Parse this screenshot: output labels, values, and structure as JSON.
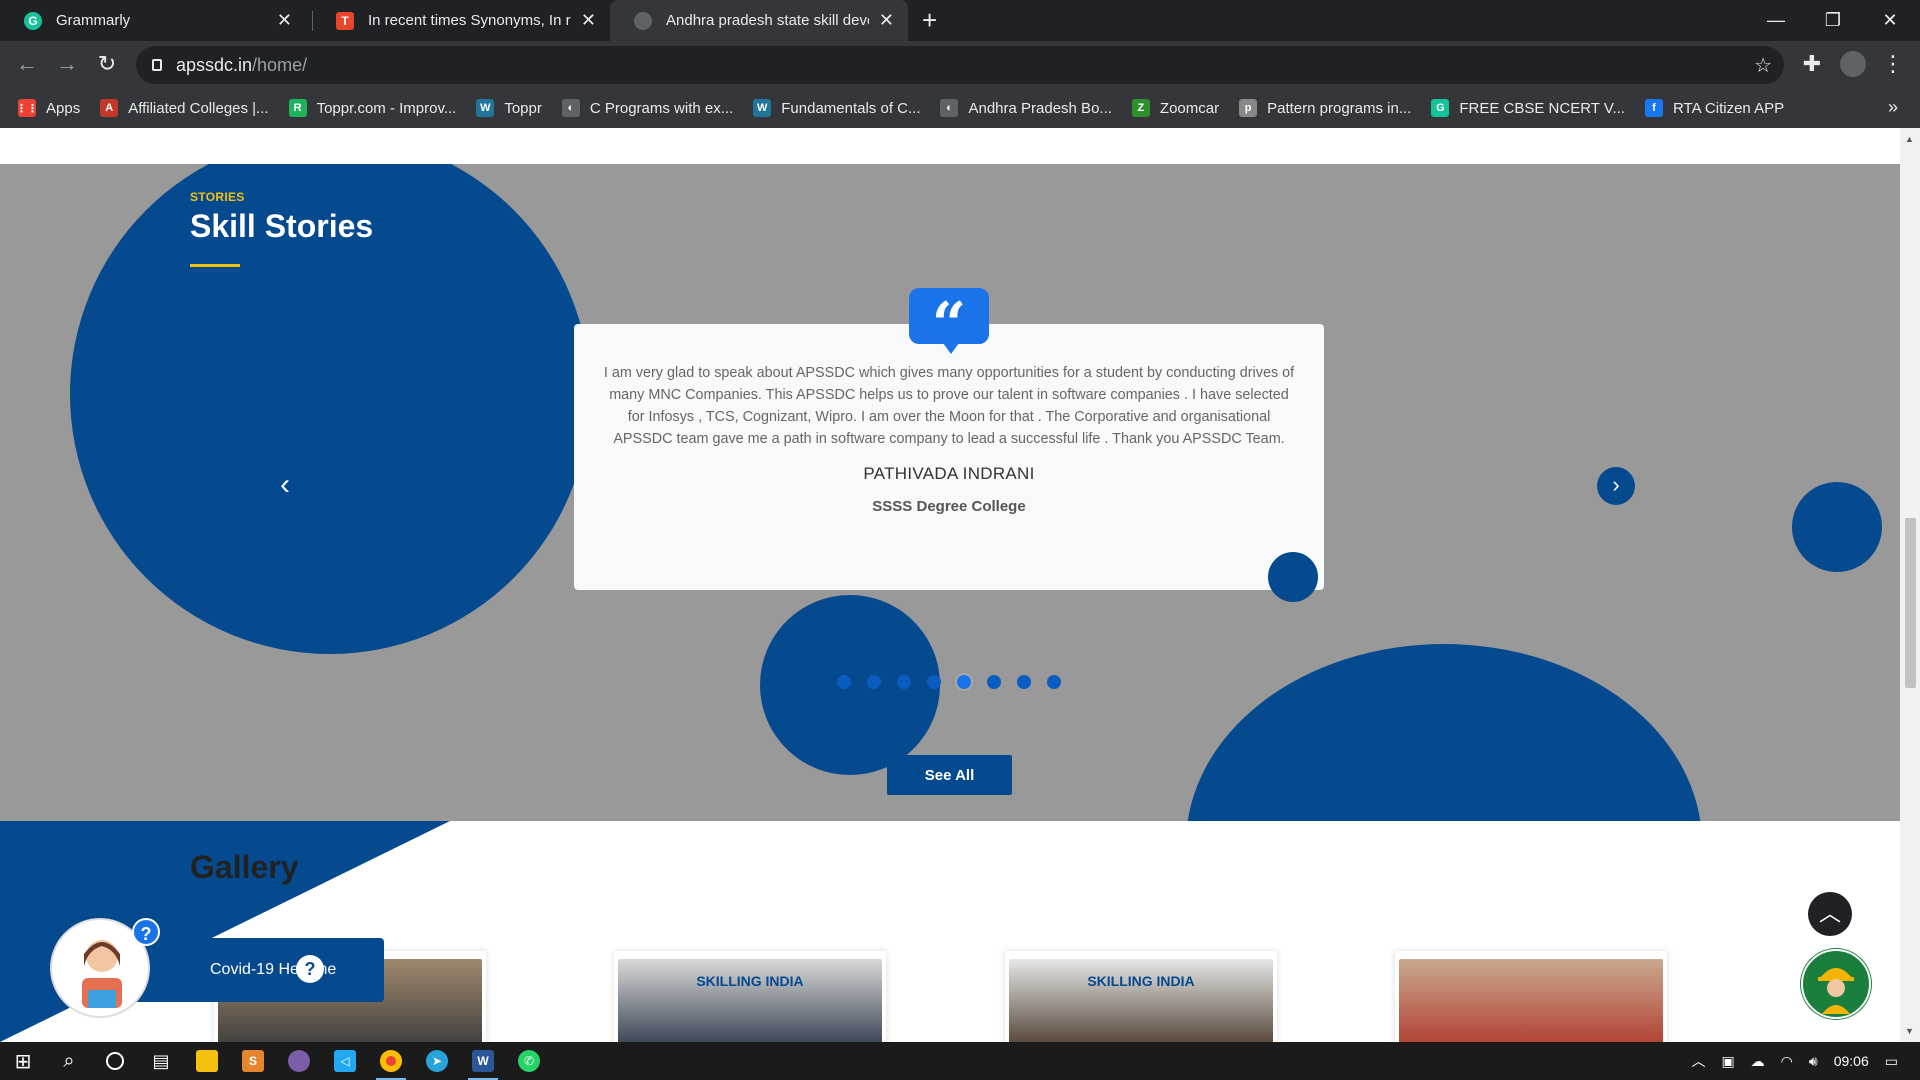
{
  "browser": {
    "tabs": [
      {
        "title": "Grammarly",
        "favicon_color": "#15c39a",
        "favicon": "G"
      },
      {
        "title": "In recent times Synonyms, In rece",
        "favicon_color": "#e8472c",
        "favicon": "T"
      },
      {
        "title": "Andhra pradesh state skill develo",
        "favicon_color": "#5f6368",
        "favicon": ""
      }
    ],
    "url_host": "apssdc.in",
    "url_path": "/home/",
    "bookmarks": [
      {
        "label": "Apps",
        "color": "#ea4335",
        "icon": "⋮⋮"
      },
      {
        "label": "Affiliated Colleges |...",
        "color": "#c0392b",
        "icon": "A"
      },
      {
        "label": "Toppr.com - Improv...",
        "color": "#1fb35c",
        "icon": "R"
      },
      {
        "label": "Toppr",
        "color": "#21759b",
        "icon": "W"
      },
      {
        "label": "C Programs with ex...",
        "color": "#5f6368",
        "icon": "◐"
      },
      {
        "label": "Fundamentals of C...",
        "color": "#21759b",
        "icon": "W"
      },
      {
        "label": "Andhra Pradesh Bo...",
        "color": "#5f6368",
        "icon": "◐"
      },
      {
        "label": "Zoomcar",
        "color": "#2d8f2d",
        "icon": "Z"
      },
      {
        "label": "Pattern programs in...",
        "color": "#888",
        "icon": "p"
      },
      {
        "label": "FREE CBSE NCERT V...",
        "color": "#15c39a",
        "icon": "G"
      },
      {
        "label": "RTA Citizen APP",
        "color": "#1877f2",
        "icon": "f"
      }
    ]
  },
  "stories": {
    "tag": "STORIES",
    "title": "Skill Stories",
    "quote": "I am very glad to speak about APSSDC which gives many opportunities for a student by conducting drives of many MNC Companies. This APSSDC helps us to prove our talent in software companies . I have selected for Infosys , TCS, Cognizant, Wipro. I am over the Moon for that . The Corporative and organisational APSSDC team gave me a path in software company to lead a successful life . Thank you APSSDC Team.",
    "name": "PATHIVADA INDRANI",
    "college": "SSSS Degree College",
    "dot_count": 8,
    "active_dot": 5,
    "see_all": "See All"
  },
  "gallery": {
    "title": "Gallery",
    "cards": [
      {
        "caption": "",
        "colors": [
          "#a0896e",
          "#3a3a3a"
        ]
      },
      {
        "caption": "SKILLING INDIA",
        "colors": [
          "#d9d9d9",
          "#2e3a4a"
        ]
      },
      {
        "caption": "SKILLING INDIA",
        "colors": [
          "#e7e7e7",
          "#4a3a2a"
        ]
      },
      {
        "caption": "",
        "colors": [
          "#c9a98e",
          "#b03a2e"
        ]
      }
    ]
  },
  "widgets": {
    "covid_label": "Covid-19 Helpline",
    "question_mark": "?",
    "help_mark": "?"
  },
  "taskbar": {
    "time": "09:06"
  },
  "colors": {
    "brand_blue": "#05498e",
    "accent_yellow": "#f4c10e",
    "stories_bg": "#999999"
  }
}
